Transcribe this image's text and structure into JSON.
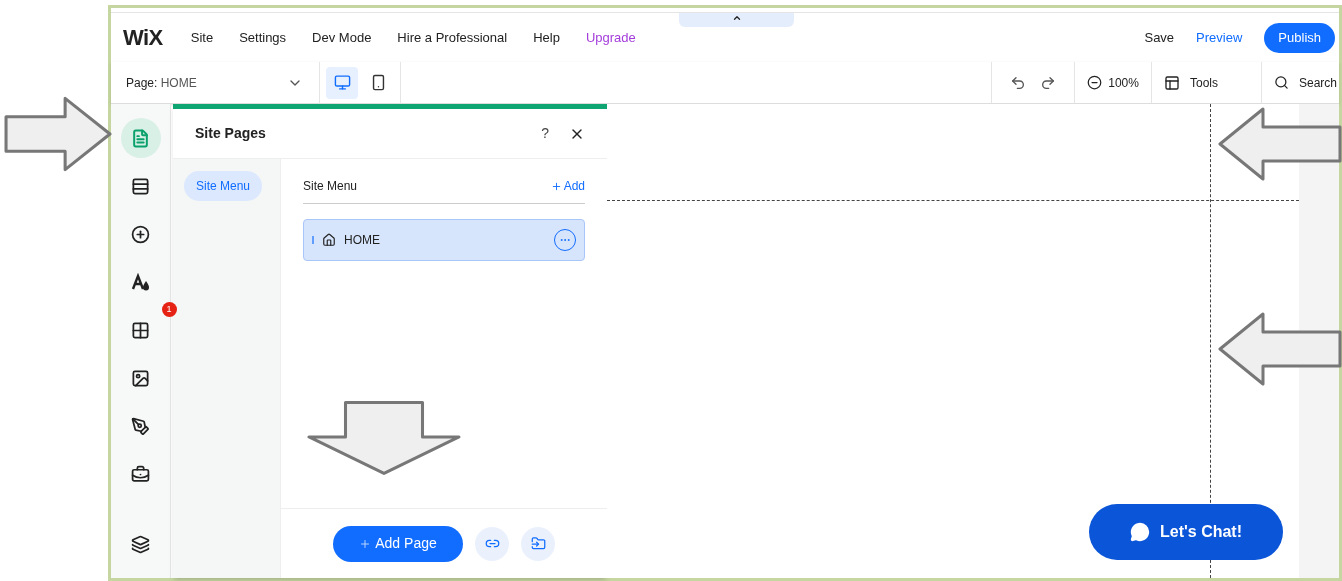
{
  "top_bar": {
    "logo": "WiX",
    "menu": [
      {
        "label": "Site",
        "kind": "normal"
      },
      {
        "label": "Settings",
        "kind": "normal"
      },
      {
        "label": "Dev Mode",
        "kind": "normal"
      },
      {
        "label": "Hire a Professional",
        "kind": "normal"
      },
      {
        "label": "Help",
        "kind": "normal"
      },
      {
        "label": "Upgrade",
        "kind": "upgrade"
      }
    ],
    "save": "Save",
    "preview": "Preview",
    "publish": "Publish"
  },
  "toolbar": {
    "page_label": "Page:",
    "page_value": "HOME",
    "devices": [
      {
        "kind": "desktop",
        "selected": true
      },
      {
        "kind": "mobile",
        "selected": false
      }
    ],
    "zoom": "100%",
    "tools": "Tools",
    "search": "Search"
  },
  "sidebar": {
    "items": [
      {
        "kind": "pages",
        "selected": true
      },
      {
        "kind": "sections",
        "selected": false
      },
      {
        "kind": "add",
        "selected": false
      },
      {
        "kind": "design",
        "selected": false
      },
      {
        "kind": "apps",
        "selected": false,
        "badge": "1"
      },
      {
        "kind": "media",
        "selected": false
      },
      {
        "kind": "pen",
        "selected": false
      },
      {
        "kind": "business",
        "selected": false
      },
      {
        "kind": "layers",
        "selected": false
      }
    ]
  },
  "panel": {
    "title": "Site Pages",
    "help": "?",
    "tabs": [
      {
        "label": "Site Menu",
        "selected": true
      }
    ],
    "list_header": "Site Menu",
    "add_link": "Add",
    "pages": [
      {
        "name": "HOME",
        "selected": true
      }
    ],
    "add_page": "Add Page"
  },
  "chat": {
    "label": "Let's Chat!"
  }
}
